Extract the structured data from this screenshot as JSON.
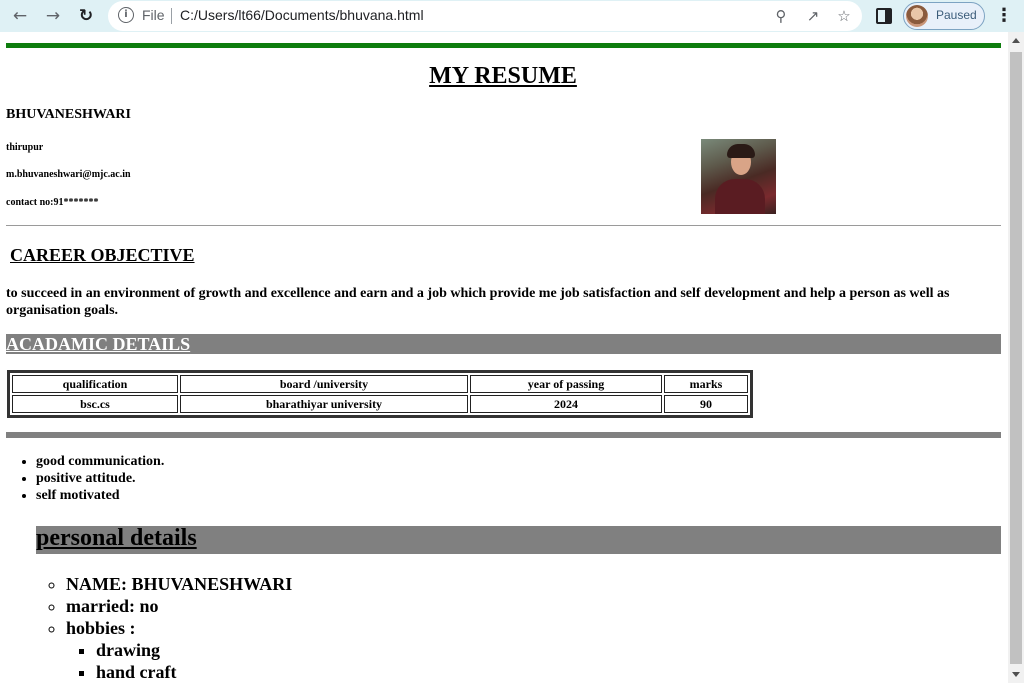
{
  "browser": {
    "file_label": "File",
    "url": "C:/Users/lt66/Documents/bhuvana.html",
    "profile_status": "Paused"
  },
  "resume": {
    "title": "MY RESUME",
    "name": "BHUVANESHWARI",
    "city": "thirupur",
    "email": "m.bhuvaneshwari@mjc.ac.in",
    "contact": "contact no:91*******",
    "career_heading": "CAREER OBJECTIVE",
    "career_text": "to succeed in an environment of growth and excellence and earn and a job which provide me job satisfaction and self development and help a person as well as organisation goals.",
    "academic_heading": "ACADAMIC DETAILS",
    "table_headers": [
      "qualification",
      "board /university",
      "year of passing",
      "marks"
    ],
    "table_rows": [
      [
        "bsc.cs",
        "bharathiyar university",
        "2024",
        "90"
      ]
    ],
    "skills": [
      "good communication.",
      "positive attitude.",
      "self motivated"
    ],
    "personal_heading": "personal details",
    "personal": [
      "NAME: BHUVANESHWARI",
      "married: no",
      "hobbies :"
    ],
    "hobbies": [
      "drawing",
      "hand craft"
    ]
  }
}
